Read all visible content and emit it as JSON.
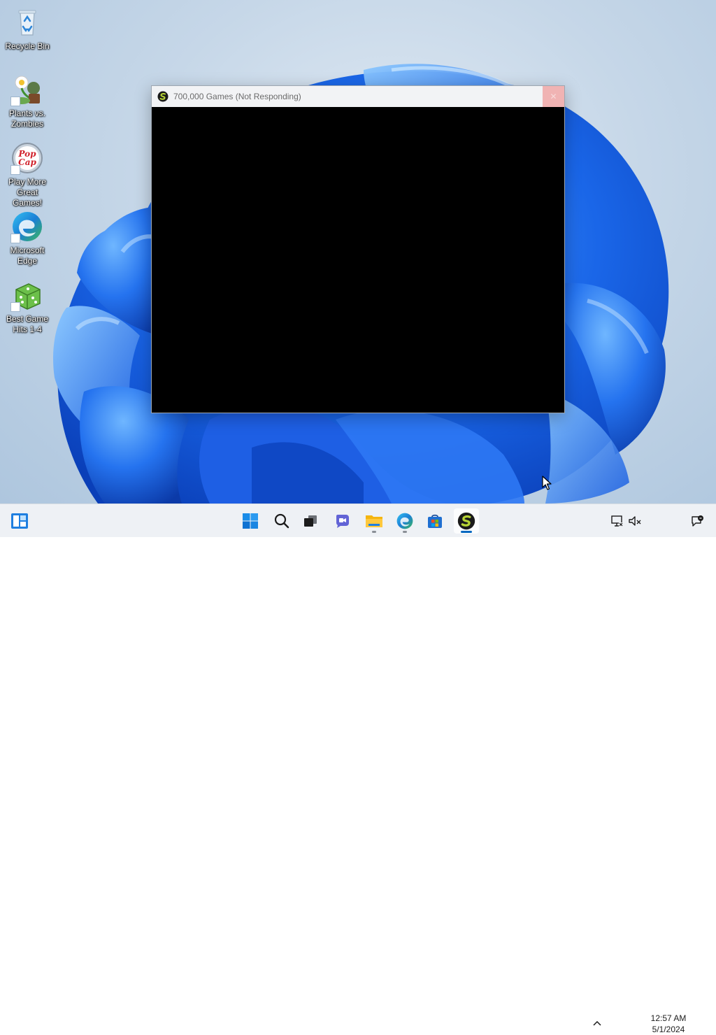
{
  "desktop": {
    "icons": [
      {
        "label": "Recycle Bin",
        "icon": "recycle-bin-icon"
      },
      {
        "label": "Plants vs. Zombies",
        "icon": "plants-vs-zombies-icon"
      },
      {
        "label": "Play More Great Games!",
        "icon": "popcap-icon"
      },
      {
        "label": "Microsoft Edge",
        "icon": "edge-icon"
      },
      {
        "label": "Best Game Hits 1-4",
        "icon": "dice-icon"
      }
    ]
  },
  "window": {
    "title": "700,000 Games (Not Responding)",
    "icon": "app-s-logo-icon",
    "close_glyph": "✕",
    "client_color": "#000000",
    "titlebar_color": "#f2f3f5",
    "close_color": "#f0b3b3"
  },
  "taskbar": {
    "widgets_icon": "widgets-icon",
    "pinned": [
      {
        "name": "start",
        "icon": "windows-start-icon",
        "running": false
      },
      {
        "name": "search",
        "icon": "search-icon",
        "running": false
      },
      {
        "name": "task-view",
        "icon": "task-view-icon",
        "running": false
      },
      {
        "name": "chat",
        "icon": "teams-chat-icon",
        "running": false
      },
      {
        "name": "file-explorer",
        "icon": "folder-icon",
        "running": true
      },
      {
        "name": "edge",
        "icon": "edge-icon",
        "running": true
      },
      {
        "name": "store",
        "icon": "store-icon",
        "running": false
      },
      {
        "name": "700000-games",
        "icon": "app-s-logo-icon",
        "running": true,
        "active": true
      }
    ],
    "tray": {
      "chevron_icon": "chevron-up-icon",
      "network_icon": "network-icon",
      "volume_icon": "volume-muted-icon",
      "notification_icon": "notification-icon",
      "time": "12:57 AM",
      "date": "5/1/2024"
    },
    "accent_color": "#0067c0"
  }
}
